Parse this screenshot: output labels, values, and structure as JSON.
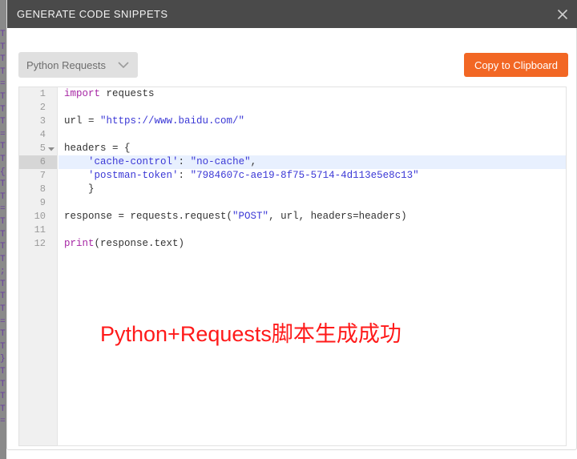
{
  "window": {
    "title": "GENERATE CODE SNIPPETS",
    "close_icon": "close-icon"
  },
  "toolbar": {
    "language_select": {
      "value": "Python Requests",
      "icon": "chevron-down-icon"
    },
    "copy_button": {
      "label": "Copy to Clipboard",
      "color": "#f26724"
    }
  },
  "editor": {
    "active_line": 6,
    "fold_lines": [
      5
    ],
    "lines": [
      {
        "num": "1",
        "tokens": [
          {
            "t": "import",
            "c": "kw"
          },
          {
            "t": " requests",
            "c": "plain"
          }
        ]
      },
      {
        "num": "2",
        "tokens": []
      },
      {
        "num": "3",
        "tokens": [
          {
            "t": "url = ",
            "c": "plain"
          },
          {
            "t": "\"https://www.baidu.com/\"",
            "c": "str"
          }
        ]
      },
      {
        "num": "4",
        "tokens": []
      },
      {
        "num": "5",
        "tokens": [
          {
            "t": "headers = {",
            "c": "plain"
          }
        ]
      },
      {
        "num": "6",
        "tokens": [
          {
            "t": "    ",
            "c": "plain"
          },
          {
            "t": "'cache-control'",
            "c": "str"
          },
          {
            "t": ": ",
            "c": "plain"
          },
          {
            "t": "\"no-cache\"",
            "c": "str"
          },
          {
            "t": ",",
            "c": "plain"
          }
        ]
      },
      {
        "num": "7",
        "tokens": [
          {
            "t": "    ",
            "c": "plain"
          },
          {
            "t": "'postman-token'",
            "c": "str"
          },
          {
            "t": ": ",
            "c": "plain"
          },
          {
            "t": "\"7984607c-ae19-8f75-5714-4d113e5e8c13\"",
            "c": "str"
          }
        ]
      },
      {
        "num": "8",
        "tokens": [
          {
            "t": "    }",
            "c": "plain"
          }
        ]
      },
      {
        "num": "9",
        "tokens": []
      },
      {
        "num": "10",
        "tokens": [
          {
            "t": "response = requests.request(",
            "c": "plain"
          },
          {
            "t": "\"POST\"",
            "c": "str"
          },
          {
            "t": ", url, headers=headers)",
            "c": "plain"
          }
        ]
      },
      {
        "num": "11",
        "tokens": []
      },
      {
        "num": "12",
        "tokens": [
          {
            "t": "print",
            "c": "kw"
          },
          {
            "t": "(response.text)",
            "c": "plain"
          }
        ]
      }
    ]
  },
  "annotation": {
    "text": "Python+Requests脚本生成成功",
    "color": "#ff1a1a"
  },
  "background_strip": {
    "lines": [
      "T",
      "T",
      "T",
      "T",
      "=",
      "T",
      "T",
      "T",
      "=",
      "T",
      "T",
      "{",
      "T",
      "T",
      "=",
      "T",
      "T",
      "T",
      "T",
      ";",
      "T",
      "T",
      "T",
      "=",
      "T",
      "T",
      "}",
      "T",
      "T",
      "T",
      "T",
      "="
    ]
  }
}
